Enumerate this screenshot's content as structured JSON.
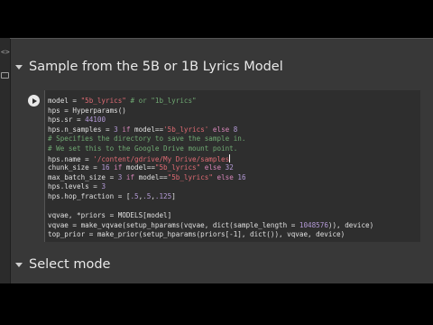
{
  "sidebar": {
    "code_icon_glyph": "<>"
  },
  "section1": {
    "title": "Sample from the 5B or 1B Lyrics Model"
  },
  "section2": {
    "title": "Select mode"
  },
  "code_lines": [
    [
      {
        "t": "model = "
      },
      {
        "t": "\"5b_lyrics\"",
        "c": "str"
      },
      {
        "t": " "
      },
      {
        "t": "# or \"1b_lyrics\"",
        "c": "cm"
      }
    ],
    [
      {
        "t": "hps = Hyperparams()"
      }
    ],
    [
      {
        "t": "hps.sr = "
      },
      {
        "t": "44100",
        "c": "num"
      }
    ],
    [
      {
        "t": "hps.n_samples = "
      },
      {
        "t": "3",
        "c": "num"
      },
      {
        "t": " "
      },
      {
        "t": "if",
        "c": "kw"
      },
      {
        "t": " model=="
      },
      {
        "t": "'5b_lyrics'",
        "c": "str"
      },
      {
        "t": " "
      },
      {
        "t": "else",
        "c": "kw"
      },
      {
        "t": " "
      },
      {
        "t": "8",
        "c": "num"
      }
    ],
    [
      {
        "t": "# Specifies the directory to save the sample in.",
        "c": "cm"
      }
    ],
    [
      {
        "t": "# We set this to the Google Drive mount point.",
        "c": "cm"
      }
    ],
    [
      {
        "t": "hps.name = "
      },
      {
        "t": "'/content/gdrive/My Drive/samples",
        "c": "str"
      },
      {
        "t": "|",
        "c": "cursor"
      }
    ],
    [
      {
        "t": "chunk_size = "
      },
      {
        "t": "16",
        "c": "num"
      },
      {
        "t": " "
      },
      {
        "t": "if",
        "c": "kw"
      },
      {
        "t": " model=="
      },
      {
        "t": "\"5b_lyrics\"",
        "c": "str"
      },
      {
        "t": " "
      },
      {
        "t": "else",
        "c": "kw"
      },
      {
        "t": " "
      },
      {
        "t": "32",
        "c": "num"
      }
    ],
    [
      {
        "t": "max_batch_size = "
      },
      {
        "t": "3",
        "c": "num"
      },
      {
        "t": " "
      },
      {
        "t": "if",
        "c": "kw"
      },
      {
        "t": " model=="
      },
      {
        "t": "\"5b_lyrics\"",
        "c": "str"
      },
      {
        "t": " "
      },
      {
        "t": "else",
        "c": "kw"
      },
      {
        "t": " "
      },
      {
        "t": "16",
        "c": "num"
      }
    ],
    [
      {
        "t": "hps.levels = "
      },
      {
        "t": "3",
        "c": "num"
      }
    ],
    [
      {
        "t": "hps.hop_fraction = ["
      },
      {
        "t": ".5",
        "c": "num"
      },
      {
        "t": ","
      },
      {
        "t": ".5",
        "c": "num"
      },
      {
        "t": ","
      },
      {
        "t": ".125",
        "c": "num"
      },
      {
        "t": "]"
      }
    ],
    [
      {
        "t": ""
      }
    ],
    [
      {
        "t": "vqvae, *priors = MODELS[model]"
      }
    ],
    [
      {
        "t": "vqvae = make_vqvae(setup_hparams(vqvae, dict(sample_length = "
      },
      {
        "t": "1048576",
        "c": "num"
      },
      {
        "t": ")), device)"
      }
    ],
    [
      {
        "t": "top_prior = make_prior(setup_hparams(priors[-1], dict()), vqvae, device)"
      }
    ]
  ]
}
